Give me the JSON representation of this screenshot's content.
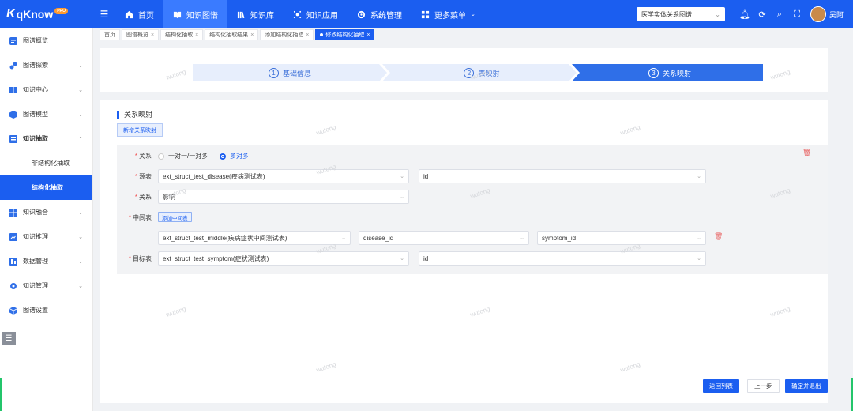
{
  "app": {
    "logo_k": "K",
    "logo_text": "qKnow",
    "logo_badge": "PRO"
  },
  "header": {
    "nav": [
      {
        "label": "首页",
        "icon": "home-icon",
        "active": false
      },
      {
        "label": "知识图谱",
        "icon": "book-icon",
        "active": true
      },
      {
        "label": "知识库",
        "icon": "library-icon",
        "active": false
      },
      {
        "label": "知识应用",
        "icon": "app-icon",
        "active": false
      },
      {
        "label": "系统管理",
        "icon": "settings-icon",
        "active": false
      },
      {
        "label": "更多菜单",
        "icon": "more-icon",
        "active": false
      }
    ],
    "graph_select": "医学实体关系图谱",
    "username": "吴阿"
  },
  "sidebar": {
    "items": [
      {
        "label": "图谱概览",
        "chevron": false
      },
      {
        "label": "图谱探索",
        "chevron": true
      },
      {
        "label": "知识中心",
        "chevron": true
      },
      {
        "label": "图谱模型",
        "chevron": true
      },
      {
        "label": "知识抽取",
        "chevron": true,
        "open": true
      }
    ],
    "sub_items": [
      {
        "label": "非结构化抽取",
        "active": false
      },
      {
        "label": "结构化抽取",
        "active": true
      }
    ],
    "items_after": [
      {
        "label": "知识融合"
      },
      {
        "label": "知识推理"
      },
      {
        "label": "数据管理"
      },
      {
        "label": "知识管理"
      },
      {
        "label": "图谱设置"
      }
    ],
    "collapse_glyph": "☰"
  },
  "tabs": [
    {
      "label": "首页",
      "closable": false
    },
    {
      "label": "图谱概览",
      "closable": true
    },
    {
      "label": "结构化抽取",
      "closable": true
    },
    {
      "label": "结构化抽取结果",
      "closable": true
    },
    {
      "label": "添加结构化抽取",
      "closable": true
    },
    {
      "label": "修改结构化抽取",
      "closable": true,
      "active": true
    }
  ],
  "steps": [
    {
      "num": "1",
      "label": "基础信息"
    },
    {
      "num": "2",
      "label": "表映射"
    },
    {
      "num": "3",
      "label": "关系映射",
      "active": true
    }
  ],
  "main": {
    "section_title": "关系映射",
    "add_mapping_button": "新增关系映射",
    "form": {
      "relation_type_label": "关系",
      "relation_options": [
        {
          "label": "一对一/一对多",
          "selected": false
        },
        {
          "label": "多对多",
          "selected": true
        }
      ],
      "source_table_label": "源表",
      "source_table": "ext_struct_test_disease(疾病测试表)",
      "source_field": "id",
      "relation_label": "关系",
      "relation_value": "影响",
      "middle_table_label": "中间表",
      "add_middle_button": "添加中间表",
      "middle_table": "ext_struct_test_middle(疾病症状中间测试表)",
      "middle_field_1": "disease_id",
      "middle_field_2": "symptom_id",
      "target_table_label": "目标表",
      "target_table": "ext_struct_test_symptom(症状测试表)",
      "target_field": "id"
    },
    "buttons": {
      "back_to_list": "返回列表",
      "prev_step": "上一步",
      "confirm_exit": "确定并退出"
    }
  },
  "watermark": "wutong",
  "colors": {
    "primary": "#1b5ef0",
    "danger": "#e86060",
    "success": "#23c56b"
  }
}
